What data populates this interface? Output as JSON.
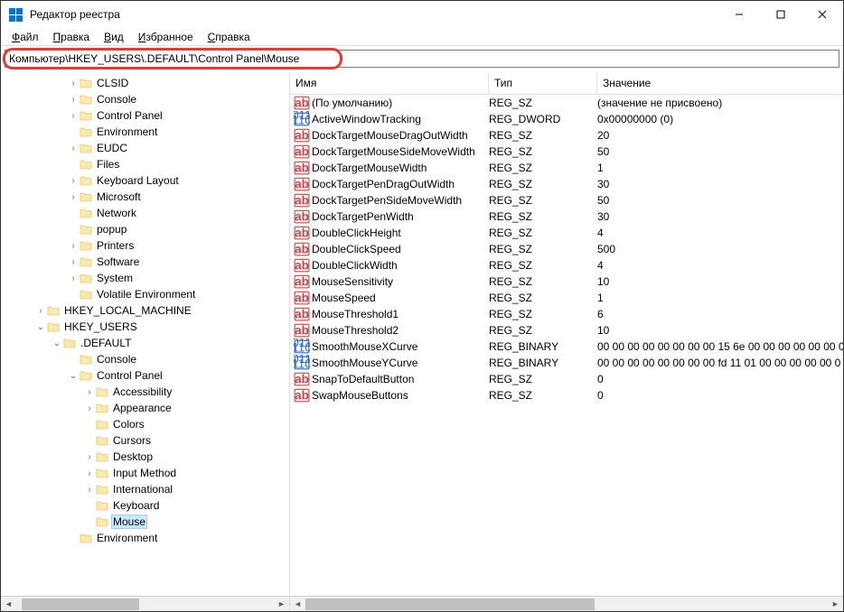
{
  "window": {
    "title": "Редактор реестра"
  },
  "menu": {
    "file": "Файл",
    "edit": "Правка",
    "view": "Вид",
    "favorites": "Избранное",
    "help": "Справка"
  },
  "address": {
    "value": "Компьютер\\HKEY_USERS\\.DEFAULT\\Control Panel\\Mouse"
  },
  "tree": [
    {
      "indent": 3,
      "chev": "›",
      "label": "CLSID"
    },
    {
      "indent": 3,
      "chev": "›",
      "label": "Console"
    },
    {
      "indent": 3,
      "chev": "›",
      "label": "Control Panel"
    },
    {
      "indent": 3,
      "chev": "",
      "label": "Environment"
    },
    {
      "indent": 3,
      "chev": "›",
      "label": "EUDC"
    },
    {
      "indent": 3,
      "chev": "",
      "label": "Files"
    },
    {
      "indent": 3,
      "chev": "›",
      "label": "Keyboard Layout"
    },
    {
      "indent": 3,
      "chev": "›",
      "label": "Microsoft"
    },
    {
      "indent": 3,
      "chev": "",
      "label": "Network"
    },
    {
      "indent": 3,
      "chev": "",
      "label": "popup"
    },
    {
      "indent": 3,
      "chev": "›",
      "label": "Printers"
    },
    {
      "indent": 3,
      "chev": "›",
      "label": "Software"
    },
    {
      "indent": 3,
      "chev": "›",
      "label": "System"
    },
    {
      "indent": 3,
      "chev": "",
      "label": "Volatile Environment"
    },
    {
      "indent": 1,
      "chev": "›",
      "label": "HKEY_LOCAL_MACHINE"
    },
    {
      "indent": 1,
      "chev": "⌄",
      "label": "HKEY_USERS"
    },
    {
      "indent": 2,
      "chev": "⌄",
      "label": ".DEFAULT"
    },
    {
      "indent": 3,
      "chev": "",
      "label": "Console"
    },
    {
      "indent": 3,
      "chev": "⌄",
      "label": "Control Panel"
    },
    {
      "indent": 4,
      "chev": "›",
      "label": "Accessibility"
    },
    {
      "indent": 4,
      "chev": "›",
      "label": "Appearance"
    },
    {
      "indent": 4,
      "chev": "",
      "label": "Colors"
    },
    {
      "indent": 4,
      "chev": "",
      "label": "Cursors"
    },
    {
      "indent": 4,
      "chev": "›",
      "label": "Desktop"
    },
    {
      "indent": 4,
      "chev": "›",
      "label": "Input Method"
    },
    {
      "indent": 4,
      "chev": "›",
      "label": "International"
    },
    {
      "indent": 4,
      "chev": "",
      "label": "Keyboard"
    },
    {
      "indent": 4,
      "chev": "",
      "label": "Mouse",
      "selected": true
    },
    {
      "indent": 3,
      "chev": "",
      "label": "Environment"
    }
  ],
  "list": {
    "headers": {
      "name": "Имя",
      "type": "Тип",
      "value": "Значение"
    },
    "rows": [
      {
        "icon": "str",
        "name": "(По умолчанию)",
        "type": "REG_SZ",
        "value": "(значение не присвоено)"
      },
      {
        "icon": "bin",
        "name": "ActiveWindowTracking",
        "type": "REG_DWORD",
        "value": "0x00000000 (0)"
      },
      {
        "icon": "str",
        "name": "DockTargetMouseDragOutWidth",
        "type": "REG_SZ",
        "value": "20"
      },
      {
        "icon": "str",
        "name": "DockTargetMouseSideMoveWidth",
        "type": "REG_SZ",
        "value": "50"
      },
      {
        "icon": "str",
        "name": "DockTargetMouseWidth",
        "type": "REG_SZ",
        "value": "1"
      },
      {
        "icon": "str",
        "name": "DockTargetPenDragOutWidth",
        "type": "REG_SZ",
        "value": "30"
      },
      {
        "icon": "str",
        "name": "DockTargetPenSideMoveWidth",
        "type": "REG_SZ",
        "value": "50"
      },
      {
        "icon": "str",
        "name": "DockTargetPenWidth",
        "type": "REG_SZ",
        "value": "30"
      },
      {
        "icon": "str",
        "name": "DoubleClickHeight",
        "type": "REG_SZ",
        "value": "4"
      },
      {
        "icon": "str",
        "name": "DoubleClickSpeed",
        "type": "REG_SZ",
        "value": "500"
      },
      {
        "icon": "str",
        "name": "DoubleClickWidth",
        "type": "REG_SZ",
        "value": "4"
      },
      {
        "icon": "str",
        "name": "MouseSensitivity",
        "type": "REG_SZ",
        "value": "10"
      },
      {
        "icon": "str",
        "name": "MouseSpeed",
        "type": "REG_SZ",
        "value": "1"
      },
      {
        "icon": "str",
        "name": "MouseThreshold1",
        "type": "REG_SZ",
        "value": "6"
      },
      {
        "icon": "str",
        "name": "MouseThreshold2",
        "type": "REG_SZ",
        "value": "10"
      },
      {
        "icon": "bin",
        "name": "SmoothMouseXCurve",
        "type": "REG_BINARY",
        "value": "00 00 00 00 00 00 00 00 15 6e 00 00 00 00 00 00 0"
      },
      {
        "icon": "bin",
        "name": "SmoothMouseYCurve",
        "type": "REG_BINARY",
        "value": "00 00 00 00 00 00 00 00 fd 11 01 00 00 00 00 00 0"
      },
      {
        "icon": "str",
        "name": "SnapToDefaultButton",
        "type": "REG_SZ",
        "value": "0"
      },
      {
        "icon": "str",
        "name": "SwapMouseButtons",
        "type": "REG_SZ",
        "value": "0"
      }
    ]
  }
}
